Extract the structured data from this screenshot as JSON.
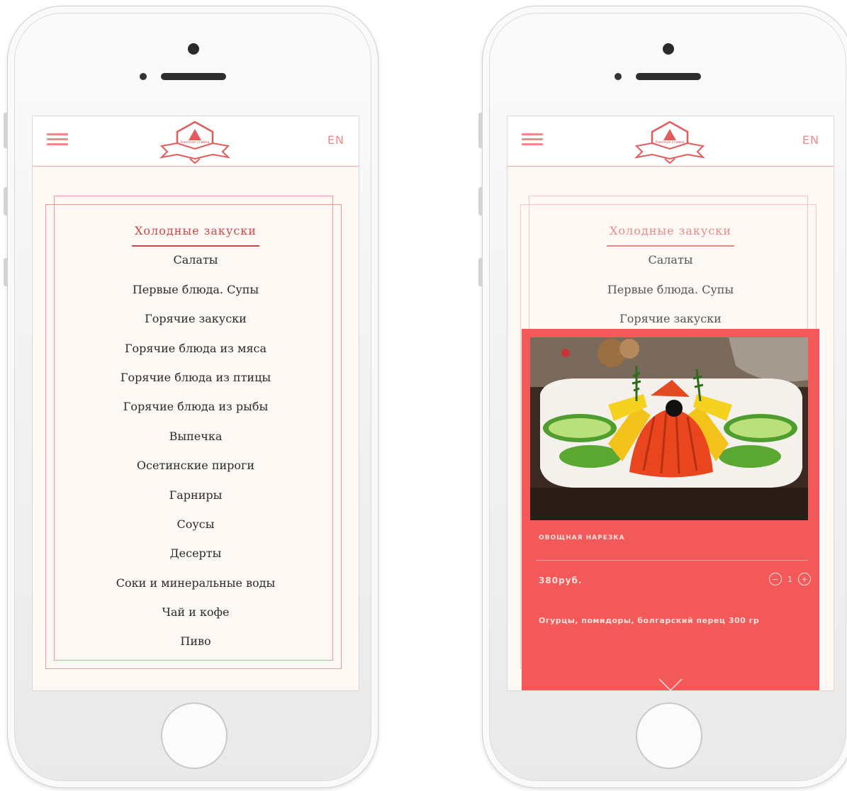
{
  "app": {
    "logo_text": "Ханская ставка",
    "lang_label": "EN"
  },
  "menu": {
    "active_index": 0,
    "items": [
      "Холодные закуски",
      "Салаты",
      "Первые блюда. Супы",
      "Горячие закуски",
      "Горячие блюда из мяса",
      "Горячие блюда из птицы",
      "Горячие блюда из рыбы",
      "Выпечка",
      "Осетинские пироги",
      "Гарниры",
      "Соусы",
      "Десерты",
      "Соки и минеральные воды",
      "Чай и кофе",
      "Пиво"
    ]
  },
  "dish": {
    "name": "ОВОЩНАЯ НАРЕЗКА",
    "price": "380руб.",
    "quantity": "1",
    "minus_label": "−",
    "plus_label": "+",
    "description": "Огурцы, помидоры, болгарский перец 300 гр"
  },
  "icons": {
    "menu": "hamburger-icon",
    "close": "close-x-icon",
    "logo": "hat-emblem-icon"
  },
  "colors": {
    "accent": "#f4595a",
    "brand_red": "#c8484a",
    "menu_pink": "#ee8a8a",
    "screen_bg": "#fdf8f4"
  }
}
